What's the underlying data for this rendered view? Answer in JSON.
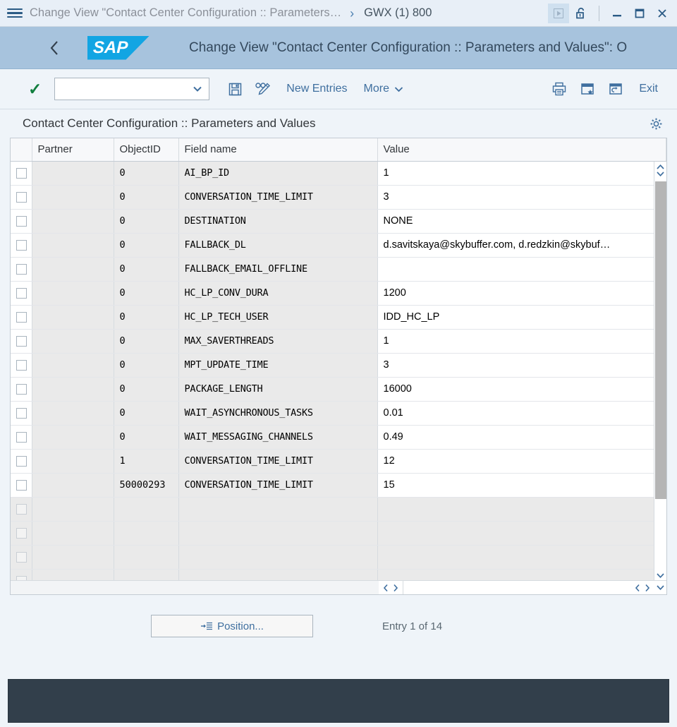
{
  "titlebar": {
    "menu_icon": "hamburger-icon",
    "title": "Change View \"Contact Center Configuration :: Parameters…",
    "breadcrumb_chevron": "›",
    "system": "GWX (1) 800",
    "play_icon": "play-icon",
    "lock_icon": "unlock-icon",
    "minimize_icon": "minimize-icon",
    "maximize_icon": "maximize-icon",
    "close_icon": "close-icon"
  },
  "shellbar": {
    "back_icon": "back-chevron-icon",
    "logo_text": "SAP",
    "title": "Change View \"Contact Center Configuration :: Parameters and Values\": O"
  },
  "toolbar": {
    "confirm_icon": "check-icon",
    "combo_value": "",
    "combo_placeholder": "",
    "chevron": "⌄",
    "save_icon": "save-floppy-icon",
    "display_change_icon": "display-change-icon",
    "new_entries_label": "New Entries",
    "more_label": "More",
    "print_icon": "print-icon",
    "favorite_icon": "create-favorite-icon",
    "open_new_window_icon": "open-in-new-window-icon",
    "exit_label": "Exit"
  },
  "section": {
    "title": "Contact Center Configuration :: Parameters and Values",
    "settings_icon": "gear-icon"
  },
  "table": {
    "columns": [
      "",
      "Partner",
      "ObjectID",
      "Field name",
      "Value"
    ],
    "rows": [
      {
        "partner": "",
        "object_id": "0",
        "field_name": "AI_BP_ID",
        "value": "1"
      },
      {
        "partner": "",
        "object_id": "0",
        "field_name": "CONVERSATION_TIME_LIMIT",
        "value": "3"
      },
      {
        "partner": "",
        "object_id": "0",
        "field_name": "DESTINATION",
        "value": "NONE"
      },
      {
        "partner": "",
        "object_id": "0",
        "field_name": "FALLBACK_DL",
        "value": "d.savitskaya@skybuffer.com, d.redzkin@skybuf…"
      },
      {
        "partner": "",
        "object_id": "0",
        "field_name": "FALLBACK_EMAIL_OFFLINE",
        "value": ""
      },
      {
        "partner": "",
        "object_id": "0",
        "field_name": "HC_LP_CONV_DURA",
        "value": "1200"
      },
      {
        "partner": "",
        "object_id": "0",
        "field_name": "HC_LP_TECH_USER",
        "value": "IDD_HC_LP"
      },
      {
        "partner": "",
        "object_id": "0",
        "field_name": "MAX_SAVERTHREADS",
        "value": "1"
      },
      {
        "partner": "",
        "object_id": "0",
        "field_name": "MPT_UPDATE_TIME",
        "value": "3"
      },
      {
        "partner": "",
        "object_id": "0",
        "field_name": "PACKAGE_LENGTH",
        "value": "16000"
      },
      {
        "partner": "",
        "object_id": "0",
        "field_name": "WAIT_ASYNCHRONOUS_TASKS",
        "value": "0.01"
      },
      {
        "partner": "",
        "object_id": "0",
        "field_name": "WAIT_MESSAGING_CHANNELS",
        "value": "0.49"
      },
      {
        "partner": "",
        "object_id": "1",
        "field_name": "CONVERSATION_TIME_LIMIT",
        "value": "12"
      },
      {
        "partner": "",
        "object_id": "50000293",
        "field_name": "CONVERSATION_TIME_LIMIT",
        "value": "15"
      }
    ],
    "empty_row_count": 4
  },
  "footer": {
    "position_label": "Position...",
    "position_icon": "position-list-icon",
    "entry_count": "Entry 1 of 14"
  },
  "colors": {
    "shell_bg": "#a7c3dd",
    "sap_blue": "#12a5e3",
    "accent_link": "#3f6f9f",
    "success_green": "#107e3e",
    "statusbar": "#323f4b"
  }
}
